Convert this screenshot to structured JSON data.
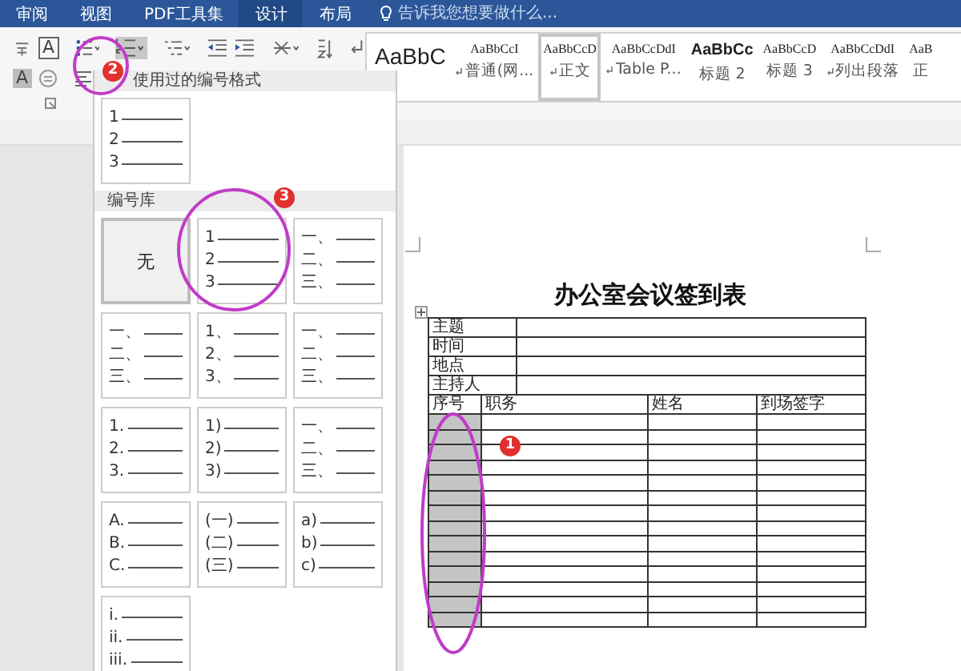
{
  "ribbon_tabs": [
    {
      "label": "审阅",
      "selected": false
    },
    {
      "label": "视图",
      "selected": false
    },
    {
      "label": "PDF工具集",
      "selected": false
    },
    {
      "label": "设计",
      "selected": true
    },
    {
      "label": "布局",
      "selected": false
    }
  ],
  "tell_me": {
    "placeholder": "告诉我您想要做什么..."
  },
  "font_tools": [
    {
      "text": "A",
      "kind": "boxed"
    },
    {
      "text": "A",
      "kind": "shaded"
    }
  ],
  "styles": [
    {
      "preview": "AaBbC",
      "kind": "large",
      "selected": false
    },
    {
      "preview": "AaBbCcI",
      "label": "普通(网...",
      "kind": "normal",
      "paragraph_mark": true,
      "selected": false
    },
    {
      "preview": "AaBbCcD",
      "label": "正文",
      "kind": "normal",
      "paragraph_mark": true,
      "selected": true
    },
    {
      "preview": "AaBbCcDdI",
      "label": "Table P...",
      "kind": "normal",
      "paragraph_mark": true,
      "selected": false
    },
    {
      "preview": "AaBbCc",
      "label": "标题 2",
      "kind": "heading",
      "paragraph_mark": false,
      "selected": false
    },
    {
      "preview": "AaBbCcD",
      "label": "标题 3",
      "kind": "normal",
      "paragraph_mark": false,
      "selected": false
    },
    {
      "preview": "AaBbCcDdI",
      "label": "列出段落",
      "kind": "normal",
      "paragraph_mark": true,
      "selected": false
    },
    {
      "preview": "AaB",
      "label": "正",
      "kind": "normal",
      "paragraph_mark": false,
      "selected": false
    }
  ],
  "numbering_menu": {
    "recent_header": "使用过的编号格式",
    "recent": [
      {
        "kind": "list",
        "markers": [
          "1",
          "2",
          "3"
        ]
      }
    ],
    "library_header": "编号库",
    "library": [
      {
        "kind": "none",
        "label": "无",
        "selected": true
      },
      {
        "kind": "list",
        "markers": [
          "1",
          "2",
          "3"
        ],
        "selected": false
      },
      {
        "kind": "list",
        "markers": [
          "一、",
          "二、",
          "三、"
        ],
        "selected": false
      },
      {
        "kind": "list",
        "markers": [
          "一、",
          "二、",
          "三、"
        ],
        "selected": false
      },
      {
        "kind": "list",
        "markers": [
          "1、",
          "2、",
          "3、"
        ],
        "selected": false
      },
      {
        "kind": "list",
        "markers": [
          "一、",
          "二、",
          "三、"
        ],
        "selected": false
      },
      {
        "kind": "list",
        "markers": [
          "1.",
          "2.",
          "3."
        ],
        "selected": false
      },
      {
        "kind": "list",
        "markers": [
          "1)",
          "2)",
          "3)"
        ],
        "selected": false
      },
      {
        "kind": "list",
        "markers": [
          "一、",
          "二、",
          "三、"
        ],
        "selected": false
      },
      {
        "kind": "list",
        "markers": [
          "A.",
          "B.",
          "C."
        ],
        "selected": false
      },
      {
        "kind": "list",
        "markers": [
          "(一)",
          "(二)",
          "(三)"
        ],
        "selected": false
      },
      {
        "kind": "list",
        "markers": [
          "a)",
          "b)",
          "c)"
        ],
        "selected": false
      },
      {
        "kind": "list",
        "markers": [
          "i.",
          "ii.",
          "iii."
        ],
        "selected": false
      }
    ]
  },
  "document": {
    "title": "办公室会议签到表",
    "info_rows": [
      "主题",
      "时间",
      "地点",
      "主持人"
    ],
    "columns": [
      {
        "label": "序号",
        "selected": true
      },
      {
        "label": "职务",
        "selected": false
      },
      {
        "label": "姓名",
        "selected": false
      },
      {
        "label": "到场签字",
        "selected": false
      }
    ]
  },
  "annotations": [
    {
      "label": "1"
    },
    {
      "label": "2"
    },
    {
      "label": "3"
    }
  ]
}
